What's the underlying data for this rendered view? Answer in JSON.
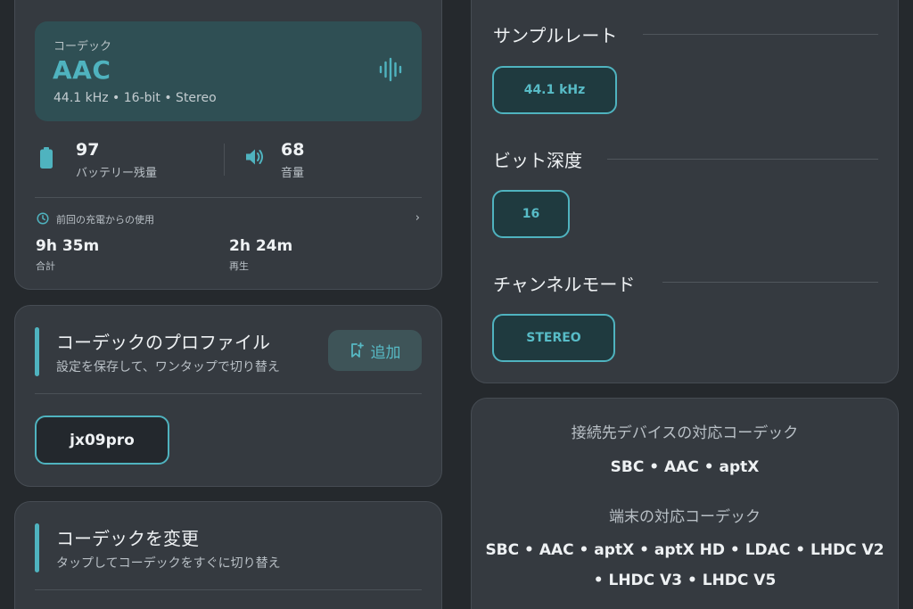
{
  "status": {
    "codec_caption": "コーデック",
    "codec_name": "AAC",
    "codec_details": "44.1 kHz • 16-bit • Stereo",
    "battery_value": "97",
    "battery_label": "バッテリー残量",
    "volume_value": "68",
    "volume_label": "音量",
    "usage_header": "前回の充電からの使用",
    "total_time": "9h 35m",
    "total_label": "合計",
    "playback_time": "2h 24m",
    "playback_label": "再生"
  },
  "profiles": {
    "title": "コーデックのプロファイル",
    "subtitle": "設定を保存して、ワンタップで切り替え",
    "add_label": "追加",
    "items": [
      "jx09pro"
    ]
  },
  "change_codec": {
    "title": "コーデックを変更",
    "subtitle": "タップしてコーデックをすぐに切り替え"
  },
  "settings": {
    "sample_rate_title": "サンプルレート",
    "sample_rate_value": "44.1 kHz",
    "bit_depth_title": "ビット深度",
    "bit_depth_value": "16",
    "channel_mode_title": "チャンネルモード",
    "channel_mode_value": "STEREO"
  },
  "support": {
    "connected_title": "接続先デバイスの対応コーデック",
    "connected_codecs": "SBC • AAC • aptX",
    "device_title": "端末の対応コーデック",
    "device_codecs": "SBC • AAC • aptX • aptX HD • LDAC • LHDC V2 • LHDC V3 • LHDC V5"
  },
  "colors": {
    "accent": "#4fb3bf",
    "card": "#353a40",
    "background": "#25292d"
  }
}
